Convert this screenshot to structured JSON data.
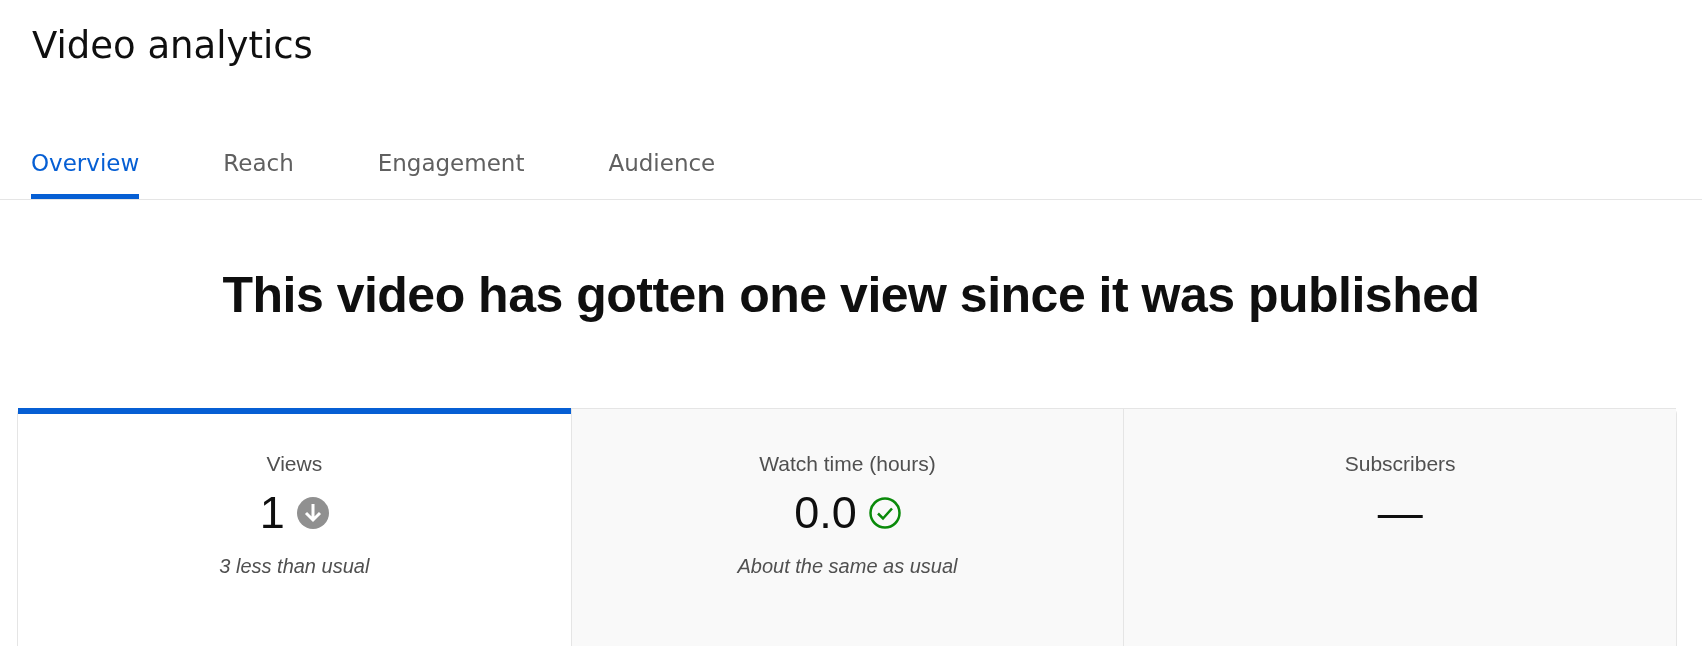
{
  "page": {
    "title": "Video analytics"
  },
  "tabs": [
    {
      "label": "Overview",
      "selected": true
    },
    {
      "label": "Reach",
      "selected": false
    },
    {
      "label": "Engagement",
      "selected": false
    },
    {
      "label": "Audience",
      "selected": false
    }
  ],
  "headline": "This video has gotten one view since it was published",
  "metrics": [
    {
      "label": "Views",
      "value": "1",
      "kind": "below",
      "note": "3 less than usual",
      "selected": true
    },
    {
      "label": "Watch time (hours)",
      "value": "0.0",
      "kind": "typical",
      "note": "About the same as usual",
      "selected": false
    },
    {
      "label": "Subscribers",
      "value": "—",
      "kind": "none",
      "selected": false
    }
  ]
}
